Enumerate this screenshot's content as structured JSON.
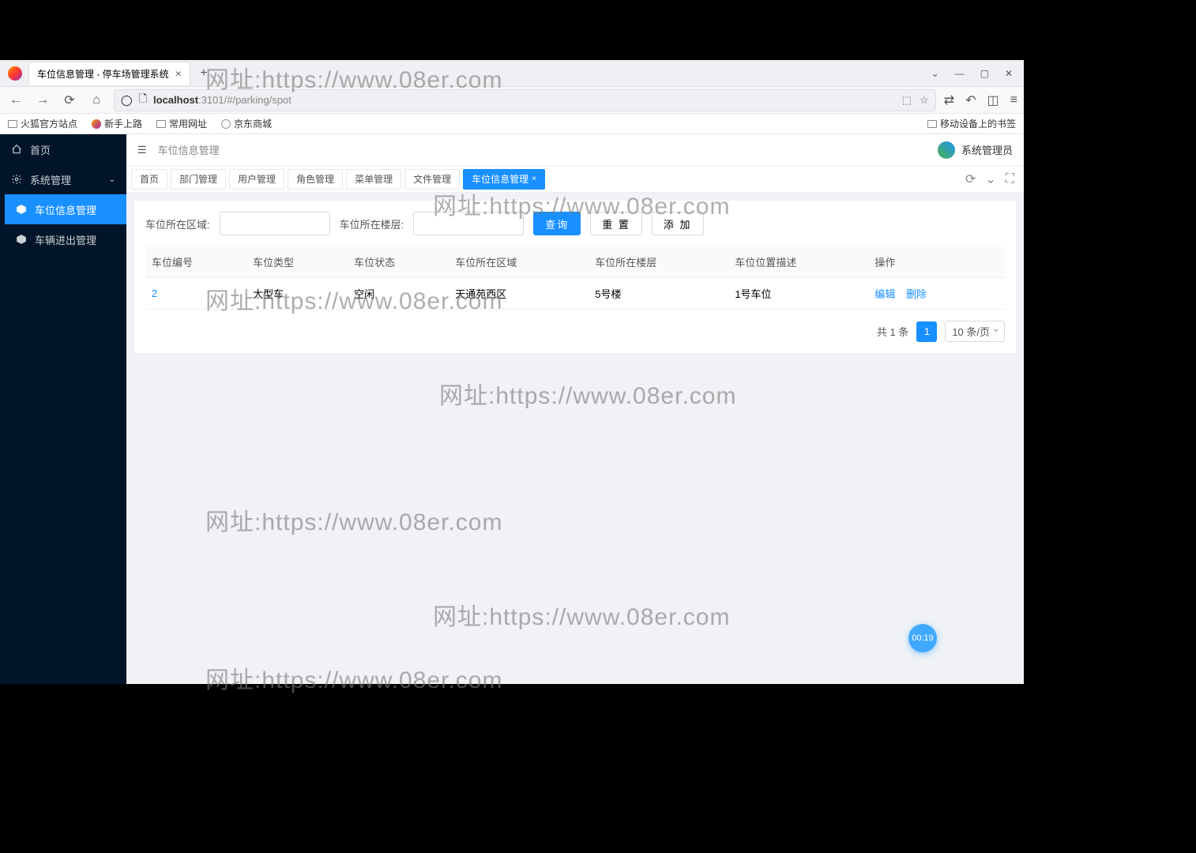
{
  "browser": {
    "tab_title": "车位信息管理 - 停车场管理系统",
    "url_host": "localhost",
    "url_path": ":3101/#/parking/spot",
    "bookmarks": [
      "火狐官方站点",
      "新手上路",
      "常用网址",
      "京东商城"
    ],
    "mobile_bookmarks": "移动设备上的书签"
  },
  "sidebar": {
    "items": [
      {
        "label": "首页",
        "icon": "home"
      },
      {
        "label": "系统管理",
        "icon": "gear",
        "expandable": true
      },
      {
        "label": "车位信息管理",
        "icon": "tag",
        "active": true
      },
      {
        "label": "车辆进出管理",
        "icon": "tag"
      }
    ]
  },
  "header": {
    "breadcrumb": "车位信息管理",
    "user_name": "系统管理员"
  },
  "page_tabs": [
    "首页",
    "部门管理",
    "用户管理",
    "角色管理",
    "菜单管理",
    "文件管理",
    "车位信息管理"
  ],
  "active_tab_index": 6,
  "search": {
    "area_label": "车位所在区域:",
    "floor_label": "车位所在楼层:",
    "query_btn": "查询",
    "reset_btn": "重 置",
    "add_btn": "添 加"
  },
  "table": {
    "columns": [
      "车位编号",
      "车位类型",
      "车位状态",
      "车位所在区域",
      "车位所在楼层",
      "车位位置描述",
      "操作"
    ],
    "rows": [
      {
        "id": "2",
        "type": "大型车",
        "status": "空闲",
        "area": "天通苑西区",
        "floor": "5号楼",
        "desc": "1号车位"
      }
    ],
    "edit_label": "编辑",
    "delete_label": "删除"
  },
  "pagination": {
    "total_text": "共 1 条",
    "current_page": "1",
    "page_size_text": "10 条/页"
  },
  "timer": "00:19",
  "watermark_text": "网址:https://www.08er.com"
}
